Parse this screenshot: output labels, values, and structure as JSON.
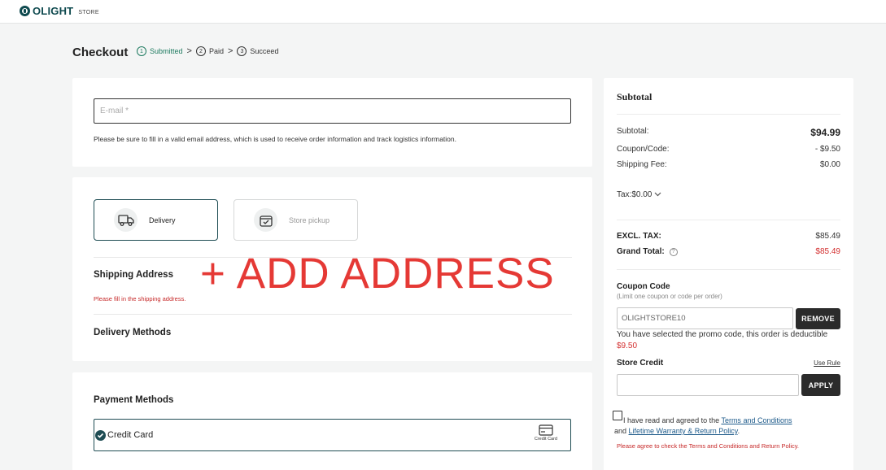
{
  "header": {
    "brand": "OLIGHT",
    "brand_suffix": "STORE"
  },
  "checkout": {
    "title": "Checkout",
    "steps": [
      {
        "num": "1",
        "label": "Submitted"
      },
      {
        "num": "2",
        "label": "Paid"
      },
      {
        "num": "3",
        "label": "Succeed"
      }
    ],
    "step_separator": ">"
  },
  "contact": {
    "email_placeholder": "E-mail *",
    "email_hint": "Please be sure to fill in a valid email address, which is used to receive order information and track logistics information."
  },
  "delivery": {
    "options": [
      {
        "label": "Delivery"
      },
      {
        "label": "Store pickup"
      }
    ],
    "shipping_address_title": "Shipping Address",
    "shipping_address_warning": "Please fill in the shipping address.",
    "add_address_annotation": "+ ADD ADDRESS",
    "delivery_methods_title": "Delivery Methods"
  },
  "payment": {
    "title": "Payment Methods",
    "selected_method": "Credit Card",
    "method_icon_label": "Credit Card"
  },
  "summary": {
    "title": "Subtotal",
    "subtotal_label": "Subtotal:",
    "subtotal_value": "$94.99",
    "coupon_label": "Coupon/Code:",
    "coupon_value": "- $9.50",
    "shipping_label": "Shipping Fee:",
    "shipping_value": "$0.00",
    "tax_label": "Tax:$0.00",
    "excl_tax_label": "EXCL. TAX:",
    "excl_tax_value": "$85.49",
    "grand_total_label": "Grand Total:",
    "grand_total_value": "$85.49",
    "coupon_title": "Coupon Code",
    "coupon_note": "(Limit one coupon or code per order)",
    "coupon_code_value": "OLIGHTSTORE10",
    "remove_label": "REMOVE",
    "promo_message": "You have selected the promo code, this order is deductible",
    "promo_amount": "$9.50",
    "store_credit_title": "Store Credit",
    "use_rule_label": "Use Rule",
    "apply_label": "APPLY",
    "agree_prefix": "I have read and agreed to the",
    "terms_link": "Terms and Conditions",
    "agree_and": "and",
    "warranty_link": "Lifetime Warranty & Return Policy",
    "agree_suffix": ".",
    "agree_warning": "Please agree to check the Terms and Conditions and Return Policy."
  },
  "colors": {
    "accent_teal": "#1f4d54",
    "success_green": "#1d7a5f",
    "error_red": "#d32f2f",
    "annotation_red": "#e53935"
  }
}
